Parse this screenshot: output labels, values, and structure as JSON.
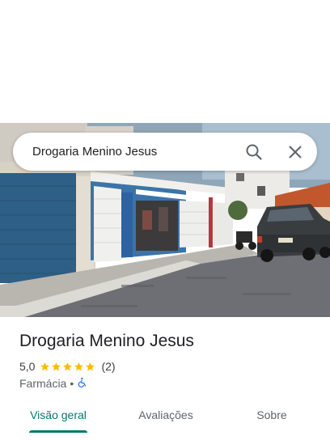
{
  "search": {
    "query": "Drogaria Menino Jesus"
  },
  "place": {
    "name": "Drogaria Menino Jesus",
    "rating": "5,0",
    "rating_value": 5.0,
    "review_count": "(2)",
    "category": "Farmácia",
    "separator": "•"
  },
  "tabs": [
    {
      "label": "Visão geral",
      "active": true
    },
    {
      "label": "Avaliações",
      "active": false
    },
    {
      "label": "Sobre",
      "active": false
    }
  ],
  "colors": {
    "accent": "#00796b",
    "star": "#fbbc04",
    "accessibility": "#1a73e8"
  },
  "icons": {
    "search": "search-icon",
    "close": "close-icon",
    "star": "star-icon",
    "accessibility": "wheelchair-icon"
  }
}
